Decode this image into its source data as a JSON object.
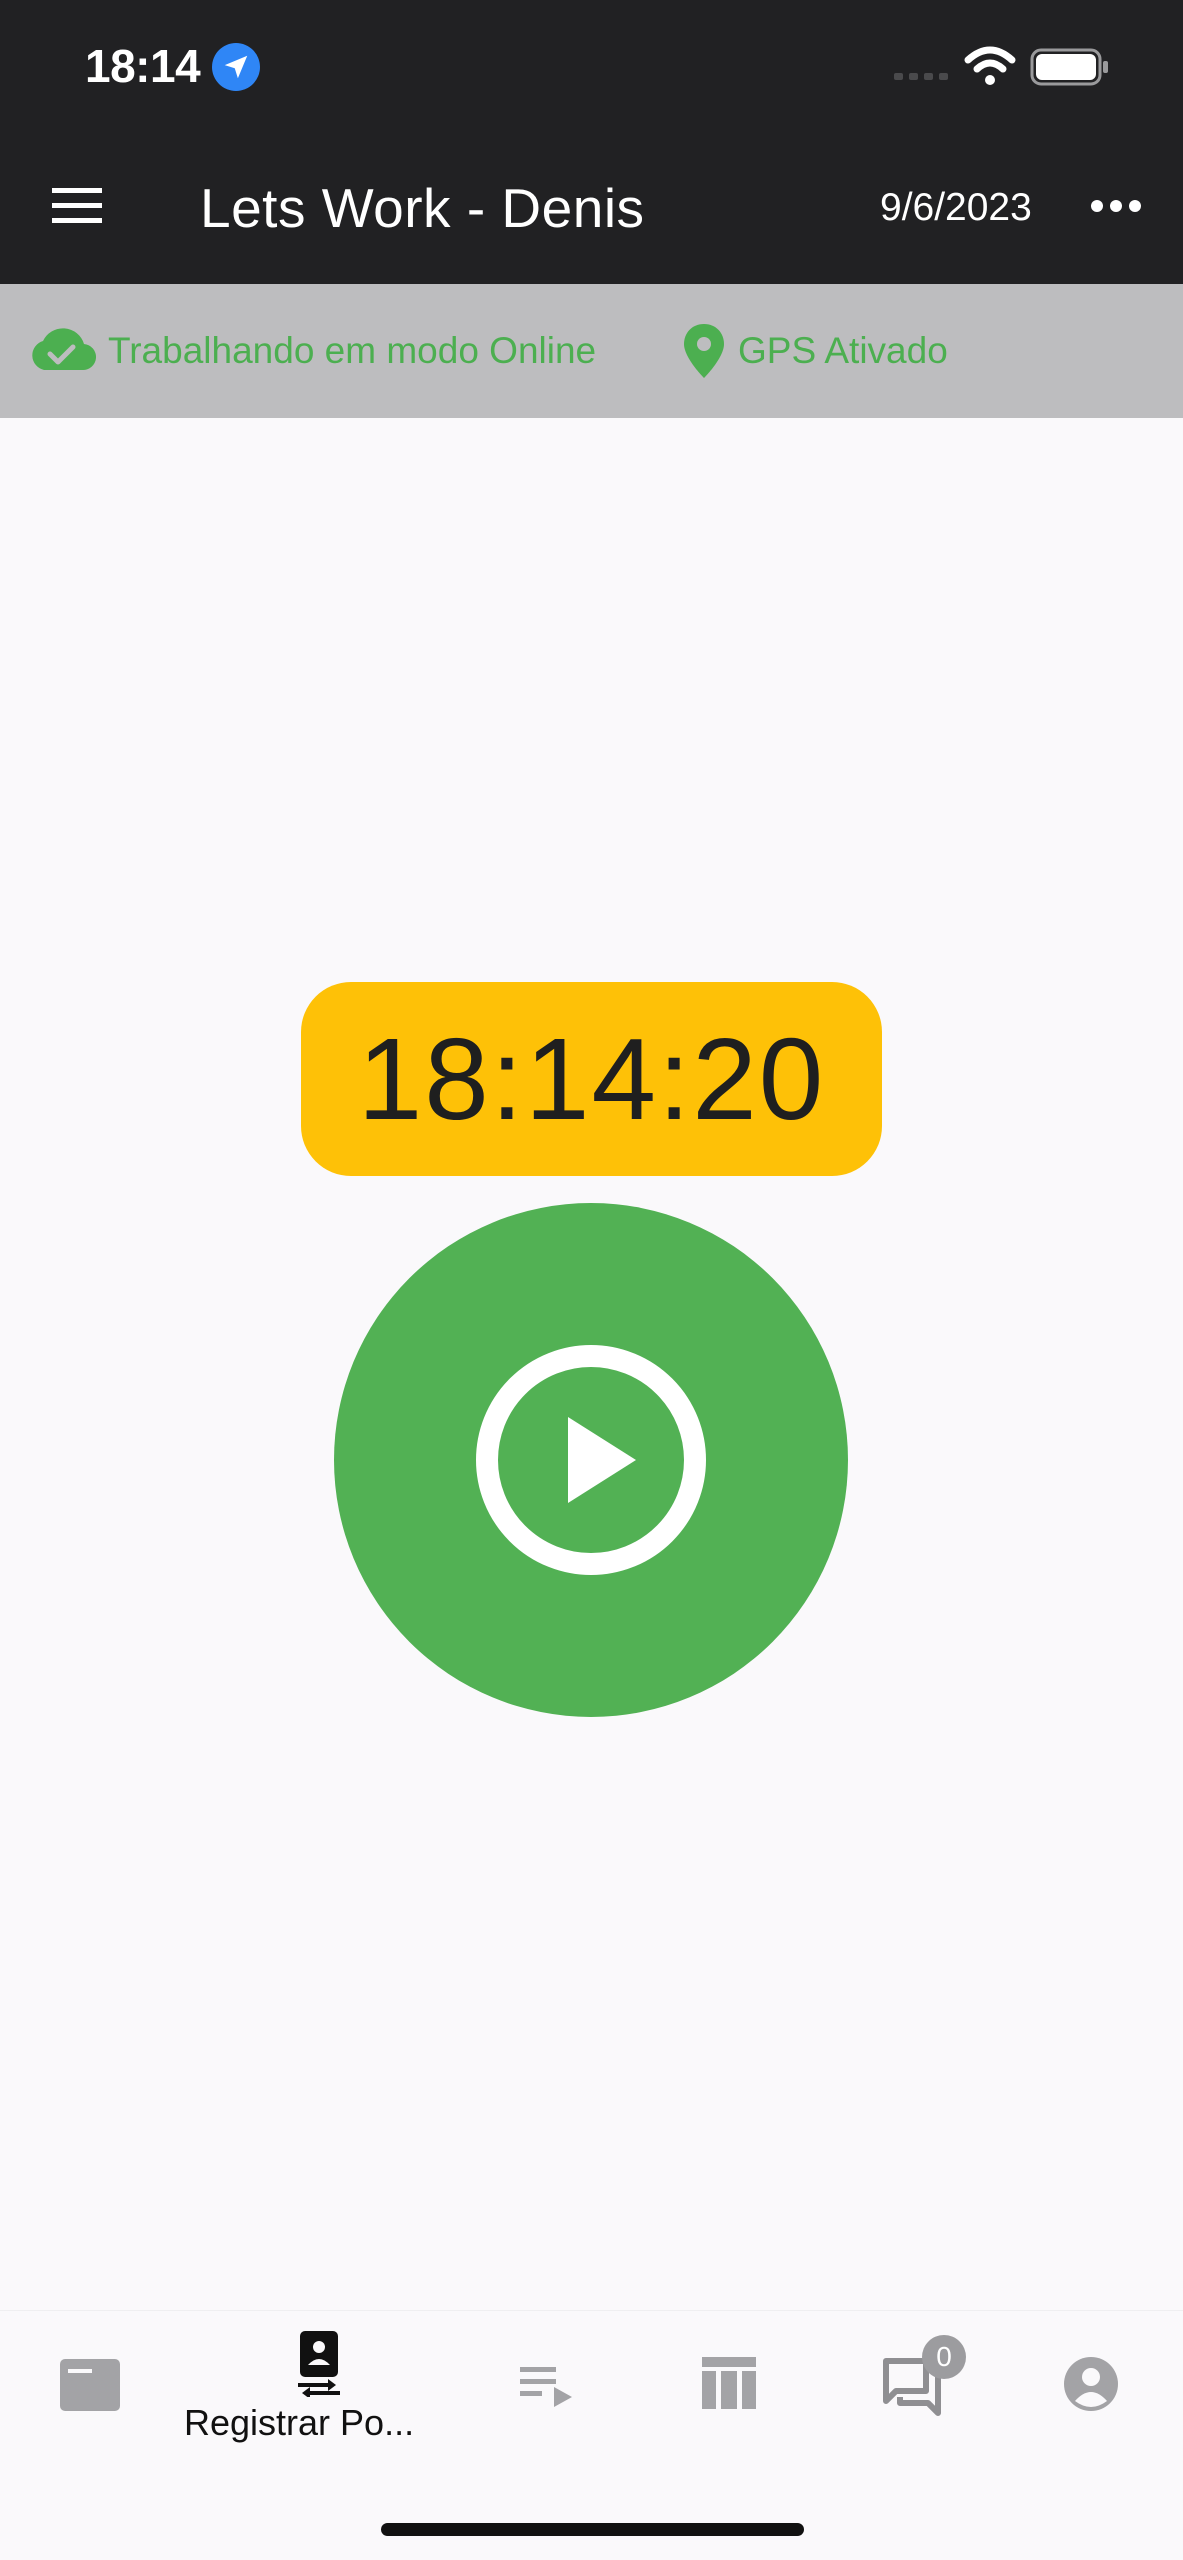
{
  "status_bar": {
    "time": "18:14",
    "icons": [
      "location-arrow-icon",
      "cellular-signal-icon",
      "wifi-icon",
      "battery-icon"
    ]
  },
  "app_bar": {
    "title": "Lets Work - Denis",
    "date": "9/6/2023",
    "icons": [
      "menu-icon",
      "more-icon"
    ]
  },
  "connection_banner": {
    "online_text": "Trabalhando em modo Online",
    "gps_text": "GPS Ativado",
    "icons": [
      "cloud-check-icon",
      "map-pin-icon"
    ],
    "text_color": "#4caf50"
  },
  "clock": {
    "time": "18:14:20",
    "background_color": "#fec107"
  },
  "play_button": {
    "icon": "play-circle-icon",
    "background_color": "#52b154"
  },
  "bottom_nav": {
    "active_label": "Registrar Po...",
    "items": [
      {
        "icon": "news-icon"
      },
      {
        "icon": "register-point-icon",
        "label": "Registrar Po...",
        "active": true
      },
      {
        "icon": "playlist-icon"
      },
      {
        "icon": "table-icon"
      },
      {
        "icon": "chat-icon",
        "badge": "0"
      },
      {
        "icon": "account-icon"
      }
    ]
  }
}
